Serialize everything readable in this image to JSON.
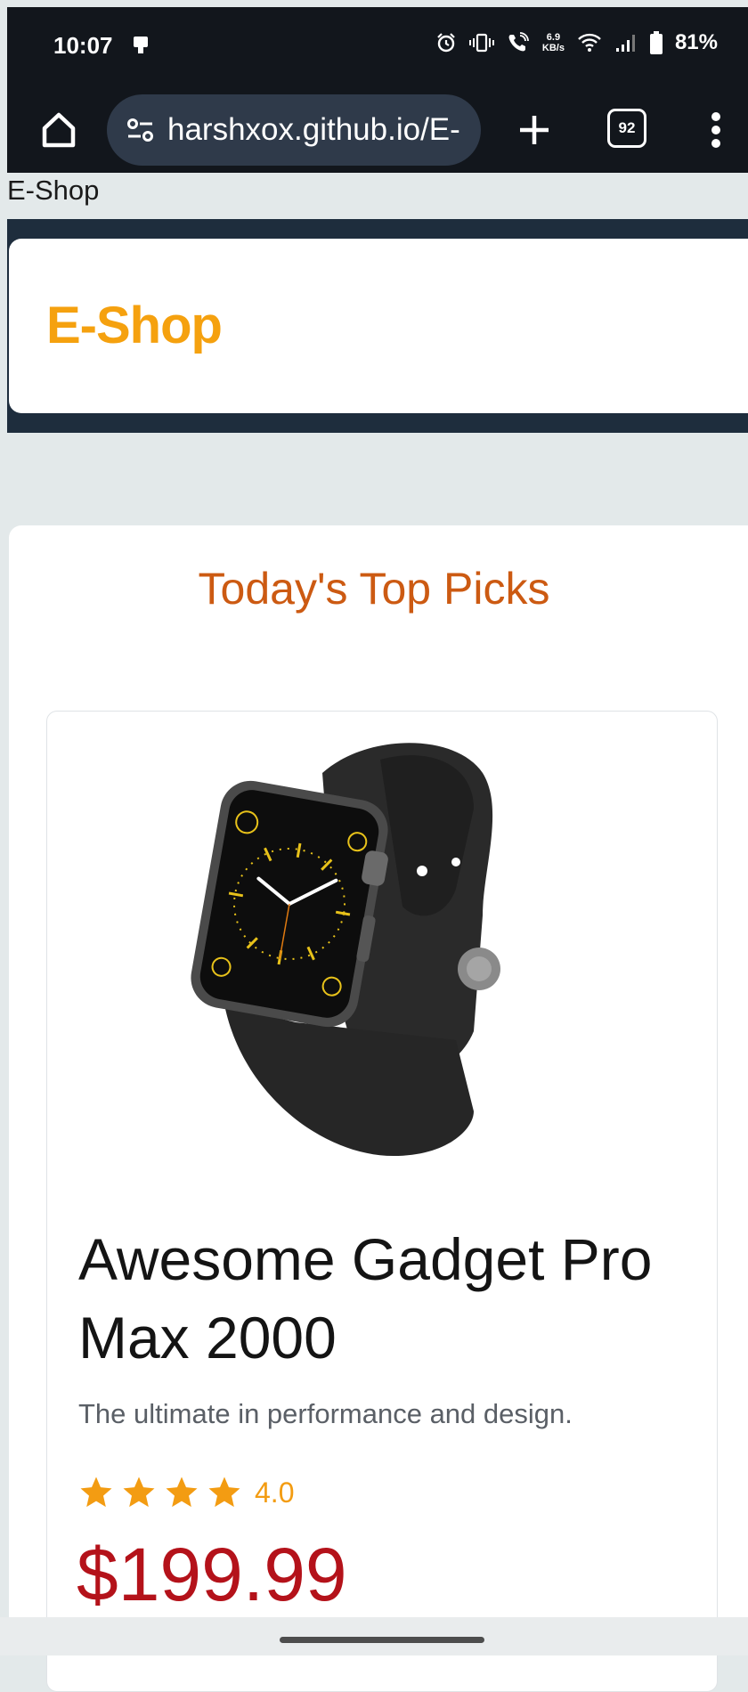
{
  "status_bar": {
    "time": "10:07",
    "net_speed_value": "6.9",
    "net_speed_unit": "KB/s",
    "battery": "81%"
  },
  "browser": {
    "url": "harshxox.github.io/E-",
    "tab_count": "92"
  },
  "page": {
    "tab_title": "E-Shop",
    "brand": "E-Shop",
    "section_title": "Today's Top Picks",
    "product": {
      "name": "Awesome Gadget Pro Max 2000",
      "description": "The ultimate in performance and design.",
      "rating": "4.0",
      "price": "$199.99"
    }
  },
  "colors": {
    "brand": "#f5a10f",
    "section_title": "#cc5a12",
    "price": "#b4121a",
    "star": "#f39c12",
    "header_band": "#1e2d3d"
  }
}
